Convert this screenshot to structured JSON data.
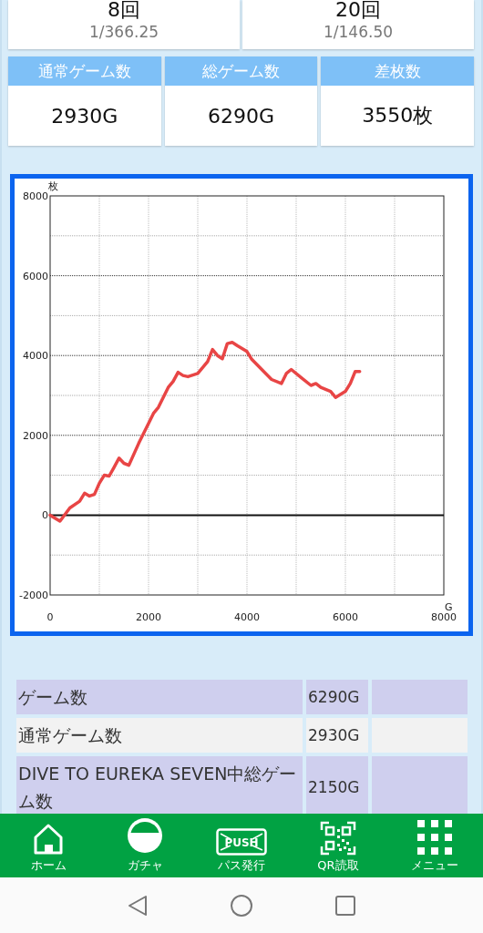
{
  "counts": [
    {
      "count": "8回",
      "rate": "1/366.25"
    },
    {
      "count": "20回",
      "rate": "1/146.50"
    }
  ],
  "stats": [
    {
      "label": "通常ゲーム数",
      "value": "2930G"
    },
    {
      "label": "総ゲーム数",
      "value": "6290G"
    },
    {
      "label": "差枚数",
      "value": "3550枚"
    }
  ],
  "graph": {
    "chart_data": {
      "type": "line",
      "grid": true,
      "xlabel": "G",
      "ylabel": "枚",
      "xlim": [
        0,
        8000
      ],
      "ylim": [
        -2000,
        8000
      ],
      "xticks": [
        0,
        2000,
        4000,
        6000,
        8000
      ],
      "yticks": [
        -2000,
        0,
        2000,
        4000,
        6000,
        8000
      ],
      "x": [
        0,
        200,
        400,
        600,
        700,
        800,
        900,
        1000,
        1100,
        1200,
        1300,
        1400,
        1500,
        1600,
        1800,
        2000,
        2100,
        2200,
        2400,
        2500,
        2600,
        2700,
        2800,
        3000,
        3200,
        3300,
        3400,
        3500,
        3600,
        3700,
        3800,
        4000,
        4100,
        4300,
        4500,
        4700,
        4800,
        4900,
        5100,
        5300,
        5400,
        5500,
        5700,
        5800,
        6000,
        6100,
        6200,
        6290
      ],
      "series": [
        {
          "color": "#e84545",
          "values": [
            0,
            -150,
            180,
            350,
            550,
            480,
            520,
            800,
            1000,
            980,
            1200,
            1430,
            1300,
            1250,
            1800,
            2300,
            2550,
            2700,
            3200,
            3350,
            3580,
            3500,
            3470,
            3550,
            3850,
            4150,
            4000,
            3920,
            4300,
            4330,
            4250,
            4100,
            3900,
            3650,
            3400,
            3300,
            3550,
            3650,
            3450,
            3250,
            3300,
            3200,
            3100,
            2950,
            3100,
            3300,
            3600,
            3600
          ]
        }
      ]
    }
  },
  "table": {
    "rows": [
      {
        "label": "ゲーム数",
        "value": "6290G"
      },
      {
        "label": "通常ゲーム数",
        "value": "2930G"
      },
      {
        "label": "DIVE TO EUREKA SEVEN中総ゲーム数",
        "value": "2150G"
      }
    ]
  },
  "tab_bar": [
    {
      "kind": "home",
      "label": "ホーム"
    },
    {
      "kind": "ball",
      "label": "ガチャ"
    },
    {
      "kind": "push",
      "label": "パス発行",
      "icon_text": "PUSH"
    },
    {
      "kind": "qr",
      "label": "QR読取"
    },
    {
      "kind": "grid",
      "label": "メニュー"
    }
  ]
}
